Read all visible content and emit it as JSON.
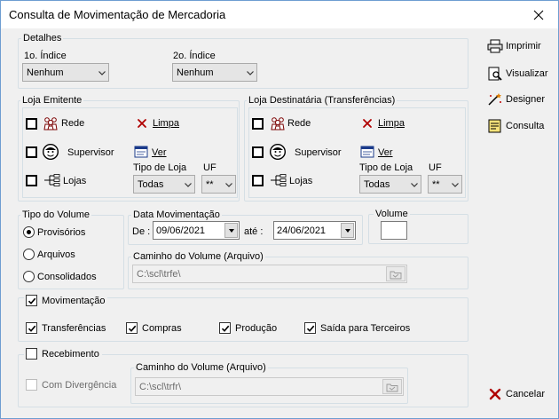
{
  "window": {
    "title": "Consulta de Movimentação de Mercadoria"
  },
  "detalhes": {
    "legend": "Detalhes",
    "indice1_label": "1o. Índice",
    "indice1_value": "Nenhum",
    "indice2_label": "2o. Índice",
    "indice2_value": "Nenhum"
  },
  "loja_emitente": {
    "legend": "Loja Emitente",
    "rede": "Rede",
    "supervisor": "Supervisor",
    "lojas": "Lojas",
    "limpa": "Limpa",
    "ver": "Ver",
    "tipo_loja_label": "Tipo de Loja",
    "tipo_loja_value": "Todas",
    "uf_label": "UF",
    "uf_value": "**"
  },
  "loja_destinataria": {
    "legend": "Loja Destinatária (Transferências)",
    "rede": "Rede",
    "supervisor": "Supervisor",
    "lojas": "Lojas",
    "limpa": "Limpa",
    "ver": "Ver",
    "tipo_loja_label": "Tipo de Loja",
    "tipo_loja_value": "Todas",
    "uf_label": "UF",
    "uf_value": "**"
  },
  "tipo_volume": {
    "legend": "Tipo do Volume",
    "options": [
      "Provisórios",
      "Arquivos",
      "Consolidados"
    ],
    "selected": "Provisórios"
  },
  "data_mov": {
    "legend": "Data Movimentação",
    "de_label": "De :",
    "de_value": "09/06/2021",
    "ate_label": "até :",
    "ate_value": "24/06/2021"
  },
  "volume": {
    "legend": "Volume",
    "value": ""
  },
  "caminho1": {
    "legend": "Caminho do Volume (Arquivo)",
    "value": "C:\\scl\\trfe\\"
  },
  "movimentacao": {
    "label": "Movimentação",
    "checked": true,
    "items": [
      {
        "label": "Transferências",
        "checked": true
      },
      {
        "label": "Compras",
        "checked": true
      },
      {
        "label": "Produção",
        "checked": true
      },
      {
        "label": "Saída para Terceiros",
        "checked": true
      }
    ]
  },
  "recebimento": {
    "label": "Recebimento",
    "checked": false,
    "com_divergencia": "Com Divergência",
    "caminho_legend": "Caminho do Volume (Arquivo)",
    "caminho_value": "C:\\scl\\trfr\\"
  },
  "side": {
    "imprimir": "Imprimir",
    "visualizar": "Visualizar",
    "designer": "Designer",
    "consulta": "Consulta",
    "cancelar": "Cancelar"
  },
  "colors": {
    "accent": "#0078d7",
    "cancel_x": "#c00000",
    "limpa_x": "#c00000",
    "checkmark": "#000000"
  }
}
